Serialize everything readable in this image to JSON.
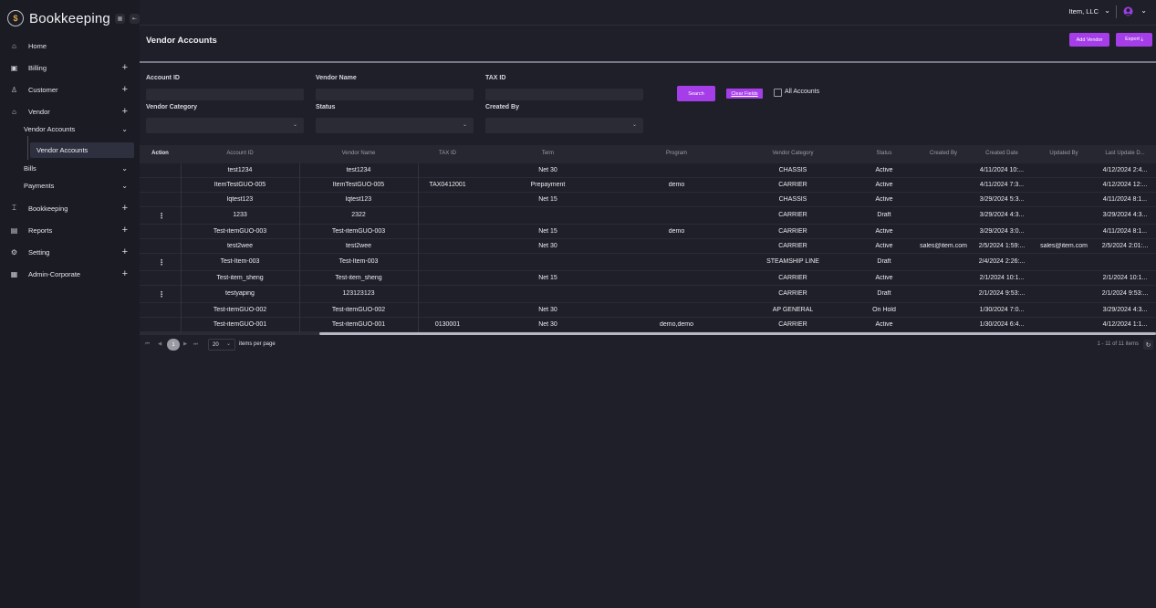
{
  "app": {
    "title": "Bookkeeping",
    "logo_glyph": "$"
  },
  "sidebar": {
    "items": [
      {
        "label": "Home",
        "icon": "store-icon",
        "glyph": "⌂",
        "trail": ""
      },
      {
        "label": "Billing",
        "icon": "billing-icon",
        "glyph": "▣",
        "trail": "+"
      },
      {
        "label": "Customer",
        "icon": "user-icon",
        "glyph": "♙",
        "trail": "+"
      },
      {
        "label": "Vendor",
        "icon": "store-icon",
        "glyph": "⌂",
        "trail": "+"
      },
      {
        "label": "Vendor Accounts",
        "icon": "",
        "glyph": "",
        "trail": "⌄"
      },
      {
        "label": "Bills",
        "icon": "",
        "glyph": "",
        "trail": "⌄"
      },
      {
        "label": "Payments",
        "icon": "",
        "glyph": "",
        "trail": "⌄"
      },
      {
        "label": "Bookkeeping",
        "icon": "bank-icon",
        "glyph": "⌶",
        "trail": "+"
      },
      {
        "label": "Reports",
        "icon": "report-icon",
        "glyph": "▤",
        "trail": "+"
      },
      {
        "label": "Setting",
        "icon": "gear-icon",
        "glyph": "⚙",
        "trail": "+"
      },
      {
        "label": "Admin-Corporate",
        "icon": "grid-icon",
        "glyph": "▦",
        "trail": "+"
      }
    ],
    "active_item": "Vendor Accounts"
  },
  "topbar": {
    "company": "Item, LLC",
    "chevron": "⌄"
  },
  "page": {
    "title": "Vendor Accounts",
    "add_vendor_label": "Add Vendor",
    "export_label": "Export ⤓"
  },
  "filters": {
    "account_id_label": "Account ID",
    "vendor_name_label": "Vendor Name",
    "tax_id_label": "TAX ID",
    "vendor_category_label": "Vendor Category",
    "status_label": "Status",
    "created_by_label": "Created By",
    "search_label": "Search",
    "clear_label": "Clear Fields",
    "all_accounts_label": "All Accounts"
  },
  "table": {
    "headers": [
      "Action",
      "Account ID",
      "Vendor Name",
      "TAX ID",
      "Term",
      "Program",
      "Vendor Category",
      "Status",
      "Created By",
      "Created Date",
      "Updated By",
      "Last Update D..."
    ],
    "rows": [
      {
        "action": "",
        "account_id": "test1234",
        "vendor_name": "test1234",
        "tax_id": "",
        "term": "Net 30",
        "program": "",
        "category": "CHASSIS",
        "status": "Active",
        "created_by": "",
        "created_date": "4/11/2024 10:...",
        "updated_by": "",
        "last_update": "4/12/2024 2:4..."
      },
      {
        "action": "",
        "account_id": "ItemTestGUO-005",
        "vendor_name": "ItemTestGUO-005",
        "tax_id": "TAX0412001",
        "term": "Prepayment",
        "program": "demo",
        "category": "CARRIER",
        "status": "Active",
        "created_by": "",
        "created_date": "4/11/2024 7:3...",
        "updated_by": "",
        "last_update": "4/12/2024 12:..."
      },
      {
        "action": "",
        "account_id": "lqtest123",
        "vendor_name": "lqtest123",
        "tax_id": "",
        "term": "Net 15",
        "program": "",
        "category": "CHASSIS",
        "status": "Active",
        "created_by": "",
        "created_date": "3/29/2024 5:3...",
        "updated_by": "",
        "last_update": "4/11/2024 8:1..."
      },
      {
        "action": "⋮",
        "account_id": "1233",
        "vendor_name": "2322",
        "tax_id": "",
        "term": "",
        "program": "",
        "category": "CARRIER",
        "status": "Draft",
        "created_by": "",
        "created_date": "3/29/2024 4:3...",
        "updated_by": "",
        "last_update": "3/29/2024 4:3..."
      },
      {
        "action": "",
        "account_id": "Test-itemGUO-003",
        "vendor_name": "Test-itemGUO-003",
        "tax_id": "",
        "term": "Net 15",
        "program": "demo",
        "category": "CARRIER",
        "status": "Active",
        "created_by": "",
        "created_date": "3/29/2024 3:0...",
        "updated_by": "",
        "last_update": "4/11/2024 8:1..."
      },
      {
        "action": "",
        "account_id": "test2wee",
        "vendor_name": "test2wee",
        "tax_id": "",
        "term": "Net 30",
        "program": "",
        "category": "CARRIER",
        "status": "Active",
        "created_by": "sales@item.com",
        "created_date": "2/5/2024 1:59:...",
        "updated_by": "sales@item.com",
        "last_update": "2/5/2024 2:01:..."
      },
      {
        "action": "⋮",
        "account_id": "Test-Item-003",
        "vendor_name": "Test-Item-003",
        "tax_id": "",
        "term": "",
        "program": "",
        "category": "STEAMSHIP LINE",
        "status": "Draft",
        "created_by": "",
        "created_date": "2/4/2024 2:26:...",
        "updated_by": "",
        "last_update": ""
      },
      {
        "action": "",
        "account_id": "Test-item_sheng",
        "vendor_name": "Test-item_sheng",
        "tax_id": "",
        "term": "Net 15",
        "program": "",
        "category": "CARRIER",
        "status": "Active",
        "created_by": "",
        "created_date": "2/1/2024 10:1...",
        "updated_by": "",
        "last_update": "2/1/2024 10:1..."
      },
      {
        "action": "⋮",
        "account_id": "testyaping",
        "vendor_name": "123123123",
        "tax_id": "",
        "term": "",
        "program": "",
        "category": "CARRIER",
        "status": "Draft",
        "created_by": "",
        "created_date": "2/1/2024 9:53:...",
        "updated_by": "",
        "last_update": "2/1/2024 9:53:..."
      },
      {
        "action": "",
        "account_id": "Test-itemGUO-002",
        "vendor_name": "Test-itemGUO-002",
        "tax_id": "",
        "term": "Net 30",
        "program": "",
        "category": "AP GENERAL",
        "status": "On Hold",
        "created_by": "",
        "created_date": "1/30/2024 7:0...",
        "updated_by": "",
        "last_update": "3/29/2024 4:3..."
      },
      {
        "action": "",
        "account_id": "Test-itemGUO-001",
        "vendor_name": "Test-itemGUO-001",
        "tax_id": "0130001",
        "term": "Net 30",
        "program": "demo,demo",
        "category": "CARRIER",
        "status": "Active",
        "created_by": "",
        "created_date": "1/30/2024 6:4...",
        "updated_by": "",
        "last_update": "4/12/2024 1:1..."
      }
    ]
  },
  "pager": {
    "first": "⏮",
    "prev": "◀",
    "current": "1",
    "next": "▶",
    "last": "⏭",
    "page_size": "20",
    "items_per_page_label": "items per page",
    "count_label": "1 - 11 of 11 items",
    "refresh": "↻"
  },
  "colors": {
    "accent": "#a53ee8",
    "background": "#1e1f28",
    "sidebar": "#1a1b23"
  }
}
